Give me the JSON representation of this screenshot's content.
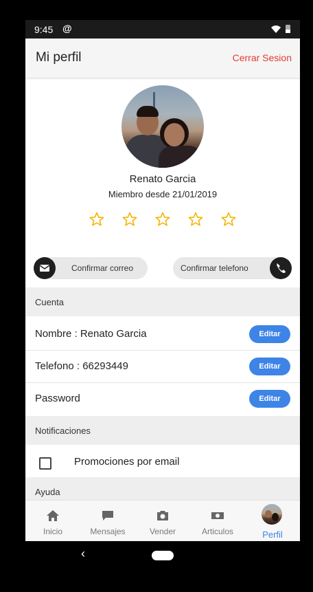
{
  "status_bar": {
    "time": "9:45",
    "app_icon": "@"
  },
  "app_bar": {
    "title": "Mi perfil",
    "logout_label": "Cerrar Sesion"
  },
  "profile": {
    "name": "Renato Garcia",
    "member_since": "Miembro desde 21/01/2019",
    "rating": 0,
    "rating_max": 5
  },
  "verify": {
    "email_label": "Confirmar correo",
    "phone_label": "Confirmar telefono"
  },
  "sections": {
    "account": "Cuenta",
    "notifications": "Notificaciones",
    "help": "Ayuda"
  },
  "account_rows": [
    {
      "label": "Nombre : Renato Garcia",
      "action": "Editar"
    },
    {
      "label": "Telefono : 66293449",
      "action": "Editar"
    },
    {
      "label": "Password",
      "action": "Editar"
    }
  ],
  "notifications": {
    "promo_email_label": "Promociones por email",
    "promo_email_checked": false
  },
  "bottom_nav": [
    {
      "label": "Inicio",
      "icon": "home-icon"
    },
    {
      "label": "Mensajes",
      "icon": "chat-icon"
    },
    {
      "label": "Vender",
      "icon": "camera-icon"
    },
    {
      "label": "Articulos",
      "icon": "money-icon"
    },
    {
      "label": "Perfil",
      "icon": "avatar",
      "active": true
    }
  ],
  "colors": {
    "accent": "#3d84e6",
    "logout": "#e53935",
    "star": "#f4b400"
  }
}
